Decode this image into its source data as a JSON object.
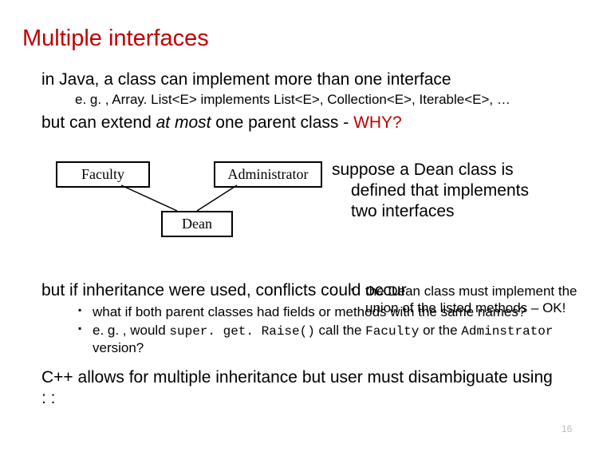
{
  "title": "Multiple interfaces",
  "line1": "in Java, a class can implement more than one interface",
  "eg": "e. g. , Array. List<E> implements List<E>, Collection<E>, Iterable<E>, …",
  "line2_a": "but can extend ",
  "line2_b": "at most",
  "line2_c": " one parent class - ",
  "line2_d": "WHY?",
  "box_faculty": "Faculty",
  "box_admin": "Administrator",
  "box_dean": "Dean",
  "suppose_l1": "suppose a Dean class is",
  "suppose_l2": "defined that implements",
  "suppose_l3": "two interfaces",
  "dean_b1": "the Dean class must implement the union of the listed methods",
  "dean_b_tail": " – OK!",
  "conflicts": "but if inheritance were used, conflicts could occur",
  "c_b1": "what if both parent classes had fields or methods with the same names?",
  "c_b2_a": "e. g. , would ",
  "c_b2_code1": "super. get. Raise()",
  "c_b2_b": " call the ",
  "c_b2_code2": "Faculty",
  "c_b2_c": " or the ",
  "c_b2_code3": "Adminstrator",
  "c_b2_d": " version?",
  "cpp_a": "C++ allows for multiple inheritance but user must disambiguate using ",
  "cpp_b": ": :",
  "page_number": "16"
}
